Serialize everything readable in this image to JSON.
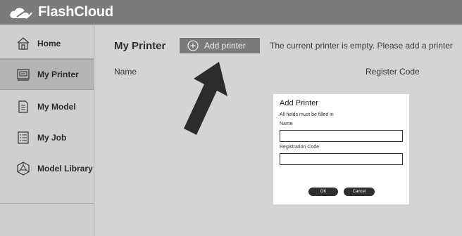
{
  "app": {
    "brand": "FlashCloud",
    "logo_icon": "cloud-logo-icon"
  },
  "sidebar": {
    "items": [
      {
        "label": "Home",
        "icon": "home-icon",
        "active": false
      },
      {
        "label": "My Printer",
        "icon": "printer-icon",
        "active": true
      },
      {
        "label": "My Model",
        "icon": "document-icon",
        "active": false
      },
      {
        "label": "My Job",
        "icon": "list-icon",
        "active": false
      },
      {
        "label": "Model Library",
        "icon": "model-library-icon",
        "active": false
      }
    ]
  },
  "main": {
    "title": "My Printer",
    "add_button_label": "Add printer",
    "empty_message": "The current printer is empty. Please add a printer",
    "columns": [
      "Name",
      "Register Code"
    ]
  },
  "dialog": {
    "title": "Add Printer",
    "note": "All fields must be filled in",
    "name_label": "Name",
    "name_value": "",
    "code_label": "Registration Code",
    "code_value": "",
    "ok_label": "OK",
    "cancel_label": "Cancel"
  },
  "colors": {
    "topbar": "#7b7b7b",
    "sidebar": "#cfcfcf",
    "sidebar_active": "#b4b4b4",
    "content_bg": "#d4d4d4",
    "button": "#7a7a7a",
    "dialog_button": "#2e2e2e"
  }
}
